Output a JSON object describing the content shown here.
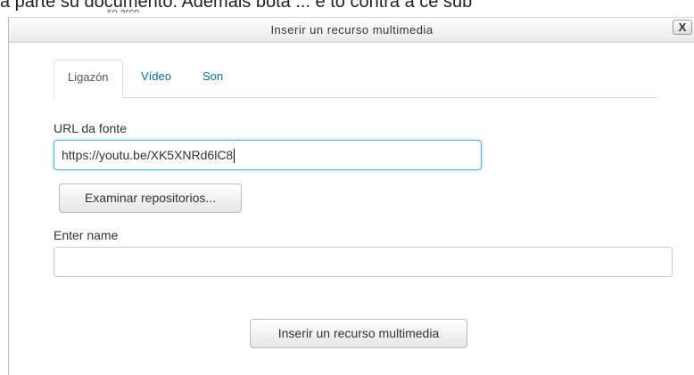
{
  "background": {
    "text": "a parte su documento. Ademais bota ... e to contra a ce sub",
    "small_text": "so arco"
  },
  "dialog": {
    "title": "Inserir un recurso multimedia",
    "close_label": "X"
  },
  "tabs": [
    {
      "label": "Ligazón",
      "active": true
    },
    {
      "label": "Vídeo",
      "active": false
    },
    {
      "label": "Son",
      "active": false
    }
  ],
  "form": {
    "source_url_label": "URL da fonte",
    "source_url_value": "https://youtu.be/XK5XNRd6lC8",
    "browse_button_label": "Examinar repositorios...",
    "name_label": "Enter name",
    "name_value": "",
    "submit_button_label": "Inserir un recurso multimedia"
  },
  "colors": {
    "link": "#0070a8",
    "focus_border": "#66afe9"
  }
}
